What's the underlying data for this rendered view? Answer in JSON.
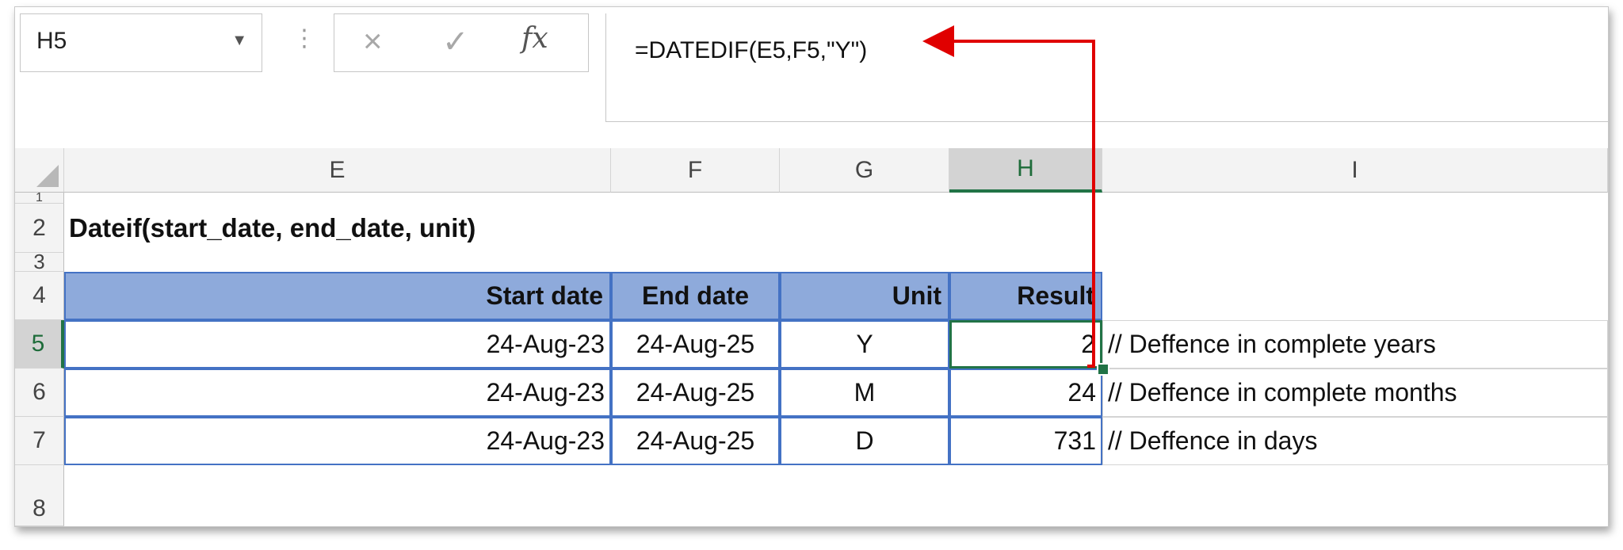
{
  "formula_bar": {
    "name_box": "H5",
    "cancel_icon": "×",
    "enter_icon": "✓",
    "function_icon": "fx",
    "formula": "=DATEDIF(E5,F5,\"Y\")"
  },
  "columns": [
    "E",
    "F",
    "G",
    "H",
    "I"
  ],
  "rows": [
    "1",
    "2",
    "3",
    "4",
    "5",
    "6",
    "7",
    "8"
  ],
  "title": "Dateif(start_date, end_date, unit)",
  "table": {
    "headers": [
      "Start date",
      "End date",
      "Unit",
      "Result"
    ],
    "rows": [
      {
        "start": "24-Aug-23",
        "end": "24-Aug-25",
        "unit": "Y",
        "result": "2",
        "comment": "// Deffence in complete years"
      },
      {
        "start": "24-Aug-23",
        "end": "24-Aug-25",
        "unit": "M",
        "result": "24",
        "comment": "// Deffence in complete months"
      },
      {
        "start": "24-Aug-23",
        "end": "24-Aug-25",
        "unit": "D",
        "result": "731",
        "comment": "// Deffence in days"
      }
    ]
  },
  "colors": {
    "header_fill": "#8eaadb",
    "table_border": "#4472c4",
    "selection": "#217346",
    "arrow": "#e00000"
  }
}
